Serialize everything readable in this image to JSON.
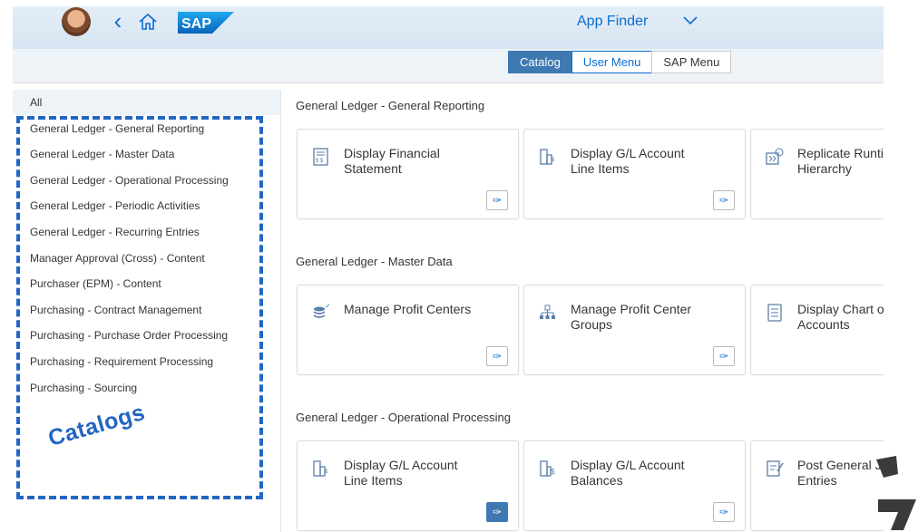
{
  "header": {
    "title": "App Finder",
    "logo_text": "SAP",
    "avatar_icon": "user-avatar",
    "back_icon": "chevron-left-icon",
    "home_icon": "home-icon",
    "title_menu_icon": "chevron-down-icon"
  },
  "view_switch": {
    "options": [
      "Catalog",
      "User Menu",
      "SAP Menu"
    ],
    "selected": "Catalog"
  },
  "sidebar": {
    "all_label": "All",
    "items": [
      "General Ledger - General Reporting",
      "General Ledger - Master Data",
      "General Ledger - Operational Processing",
      "General Ledger - Periodic Activities",
      "General Ledger - Recurring Entries",
      "Manager Approval (Cross) - Content",
      "Purchaser (EPM) - Content",
      "Purchasing - Contract Management",
      "Purchasing - Purchase Order Processing",
      "Purchasing - Requirement Processing",
      "Purchasing - Sourcing"
    ],
    "annotation": "Catalogs"
  },
  "groups": [
    {
      "title": "General Ledger - General Reporting",
      "tiles": [
        {
          "label": "Display Financial Statement",
          "icon": "financial-statement-icon",
          "pinned": false
        },
        {
          "label": "Display G/L Account Line Items",
          "icon": "account-line-items-icon",
          "pinned": false
        },
        {
          "label": "Replicate Runtime Hierarchy",
          "icon": "replicate-hierarchy-icon",
          "pinned": false
        }
      ]
    },
    {
      "title": "General Ledger - Master Data",
      "tiles": [
        {
          "label": "Manage Profit Centers",
          "icon": "profit-center-icon",
          "pinned": false
        },
        {
          "label": "Manage Profit Center Groups",
          "icon": "profit-center-groups-icon",
          "pinned": false
        },
        {
          "label": "Display Chart of Accounts",
          "icon": "chart-of-accounts-icon",
          "pinned": false
        }
      ]
    },
    {
      "title": "General Ledger - Operational Processing",
      "tiles": [
        {
          "label": "Display G/L Account Line Items",
          "icon": "account-line-items-icon",
          "pinned": true
        },
        {
          "label": "Display G/L Account Balances",
          "icon": "account-balances-icon",
          "pinned": false
        },
        {
          "label": "Post General Journal Entries",
          "icon": "post-journal-icon",
          "pinned": false
        }
      ]
    }
  ],
  "colors": {
    "accent": "#0a6ed1",
    "active_segment": "#3f79b1",
    "annotation": "#2266c4"
  }
}
